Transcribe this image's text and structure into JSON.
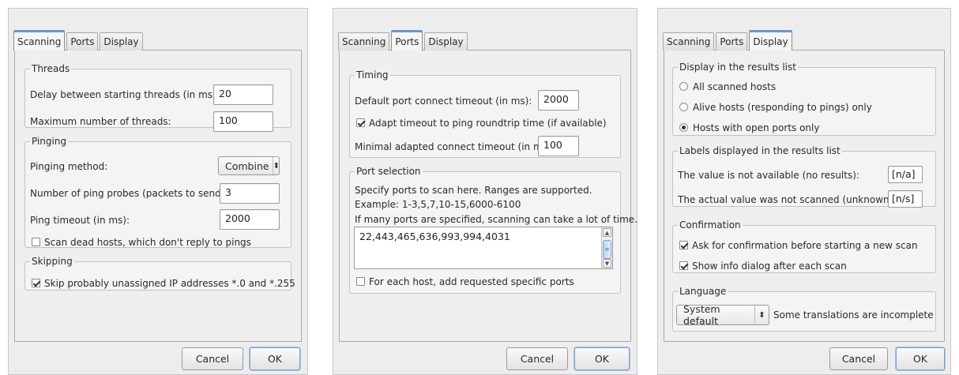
{
  "buttons": {
    "cancel": "Cancel",
    "ok": "OK"
  },
  "tabs": [
    "Scanning",
    "Ports",
    "Display"
  ],
  "scanning": {
    "threads": {
      "legend": "Threads",
      "delay_label": "Delay between starting threads (in ms):",
      "delay_value": "20",
      "max_label": "Maximum number of threads:",
      "max_value": "100"
    },
    "pinging": {
      "legend": "Pinging",
      "method_label": "Pinging method:",
      "method_value": "Combine",
      "probes_label": "Number of ping probes (packets to send):",
      "probes_value": "3",
      "timeout_label": "Ping timeout (in ms):",
      "timeout_value": "2000",
      "dead_hosts_label": "Scan dead hosts, which don't reply to pings",
      "dead_hosts_checked": false
    },
    "skipping": {
      "legend": "Skipping",
      "skip_label": "Skip probably unassigned IP addresses *.0 and *.255",
      "skip_checked": true
    }
  },
  "ports": {
    "timing": {
      "legend": "Timing",
      "connect_timeout_label": "Default port connect timeout (in ms):",
      "connect_timeout_value": "2000",
      "adapt_label": "Adapt timeout to ping roundtrip time (if available)",
      "adapt_checked": true,
      "min_adapted_label": "Minimal adapted connect timeout (in ms):",
      "min_adapted_value": "100"
    },
    "selection": {
      "legend": "Port selection",
      "line1": "Specify ports to scan here. Ranges are supported.",
      "line2": "Example: 1-3,5,7,10-15,6000-6100",
      "line3": "If many ports are specified, scanning can take a lot of time.",
      "ports_value": "22,443,465,636,993,994,4031",
      "each_host_label": "For each host, add requested specific ports",
      "each_host_checked": false
    }
  },
  "display": {
    "results": {
      "legend": "Display in the results list",
      "options": [
        "All scanned hosts",
        "Alive hosts (responding to pings) only",
        "Hosts with open ports only"
      ],
      "selected": 2
    },
    "labels": {
      "legend": "Labels displayed in the results list",
      "na_label": "The value is not available (no results):",
      "na_value": "[n/a]",
      "ns_label": "The actual value was not scanned (unknown):",
      "ns_value": "[n/s]"
    },
    "confirmation": {
      "legend": "Confirmation",
      "ask_label": "Ask for confirmation before starting a new scan",
      "ask_checked": true,
      "info_label": "Show info dialog after each scan",
      "info_checked": true
    },
    "language": {
      "legend": "Language",
      "value": "System default",
      "note": "Some translations are incomplete"
    }
  }
}
